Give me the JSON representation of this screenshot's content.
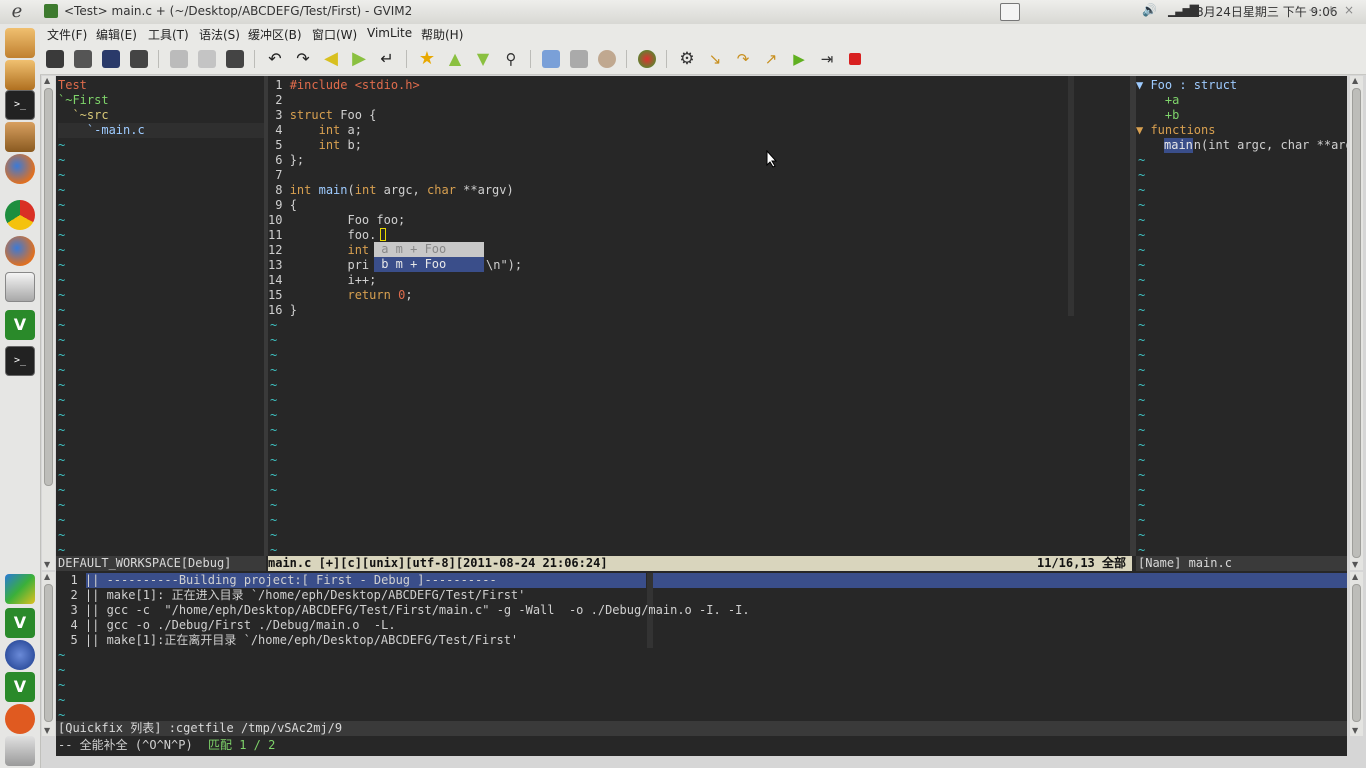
{
  "window": {
    "title": "<Test> main.c + (~/Desktop/ABCDEFG/Test/First) - GVIM2",
    "clock": "8月24日星期三 下午 9:06"
  },
  "menubar": [
    "文件(F)",
    "编辑(E)",
    "工具(T)",
    "语法(S)",
    "缓冲区(B)",
    "窗口(W)",
    "VimLite",
    "帮助(H)"
  ],
  "tree": {
    "lines": [
      "Test",
      "`~First",
      "  `~src",
      "    `-main.c"
    ]
  },
  "code": {
    "lines": [
      "#include <stdio.h>",
      "",
      "struct Foo {",
      "    int a;",
      "    int b;",
      "};",
      "",
      "int main(int argc, char **argv)",
      "{",
      "        Foo foo;",
      "        foo.",
      "        int",
      "        pri",
      "        i++;",
      "        return 0;",
      "}"
    ],
    "line13_tail": "\\n\");",
    "completion": [
      {
        "label": " a m + Foo",
        "selected": false
      },
      {
        "label": " b m + Foo",
        "selected": true
      }
    ]
  },
  "tags": {
    "lines": [
      "▼ Foo : struct",
      "    +a",
      "    +b",
      "▼ functions",
      "     main(int argc, char **argv"
    ],
    "highlight_word": "main"
  },
  "status": {
    "left": "DEFAULT_WORKSPACE[Debug]",
    "mid": "main.c [+][c][unix][utf-8][2011-08-24 21:06:24]",
    "pos": "11/16,13 全部",
    "right": "[Name] main.c"
  },
  "quickfix": {
    "lines": [
      "|| ----------Building project:[ First - Debug ]----------",
      "|| make[1]: 正在进入目录 `/home/eph/Desktop/ABCDEFG/Test/First'",
      "|| gcc -c  \"/home/eph/Desktop/ABCDEFG/Test/First/main.c\" -g -Wall  -o ./Debug/main.o -I. -I.",
      "|| gcc -o ./Debug/First ./Debug/main.o  -L.",
      "|| make[1]:正在离开目录 `/home/eph/Desktop/ABCDEFG/Test/First'"
    ],
    "status": "[Quickfix 列表] :cgetfile /tmp/vSAc2mj/9",
    "cmdline_prefix": "-- 全能补全 (^O^N^P) ",
    "cmdline_match": "匹配 1 / 2"
  },
  "tilde": "~",
  "colors": {
    "accent_select": "#3a4e8a",
    "statusline": "#d9d5bd",
    "tilde": "#3ec3c3"
  }
}
